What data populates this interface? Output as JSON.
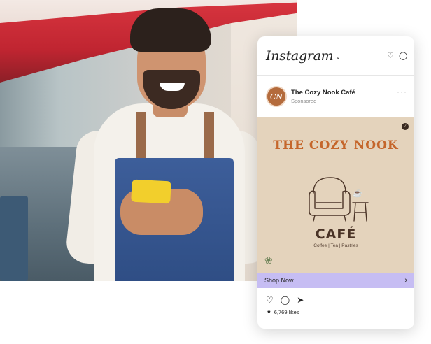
{
  "instagram": {
    "brand": "Instagram",
    "post": {
      "account_name": "The Cozy Nook Café",
      "avatar_initials": "CN",
      "sponsored_label": "Sponsored"
    },
    "ad": {
      "title": "THE COZY NOOK",
      "cafe": "CAFÉ",
      "subtitle": "Coffee | Tea | Pastries"
    },
    "cta_label": "Shop Now",
    "likes_text": "6,769 likes"
  },
  "colors": {
    "cta_background": "#c6bdf3",
    "ad_background": "#e4d3bc",
    "ad_title": "#c5662b",
    "awning_red": "#c02531",
    "apron_blue": "#2f4e85"
  },
  "icons": {
    "topbar": [
      "chevron-down-icon",
      "heart-icon",
      "messenger-icon"
    ],
    "actions": [
      "heart-icon",
      "comment-icon",
      "send-icon"
    ],
    "more": "more-horizontal-icon",
    "cta": "chevron-right-icon"
  }
}
